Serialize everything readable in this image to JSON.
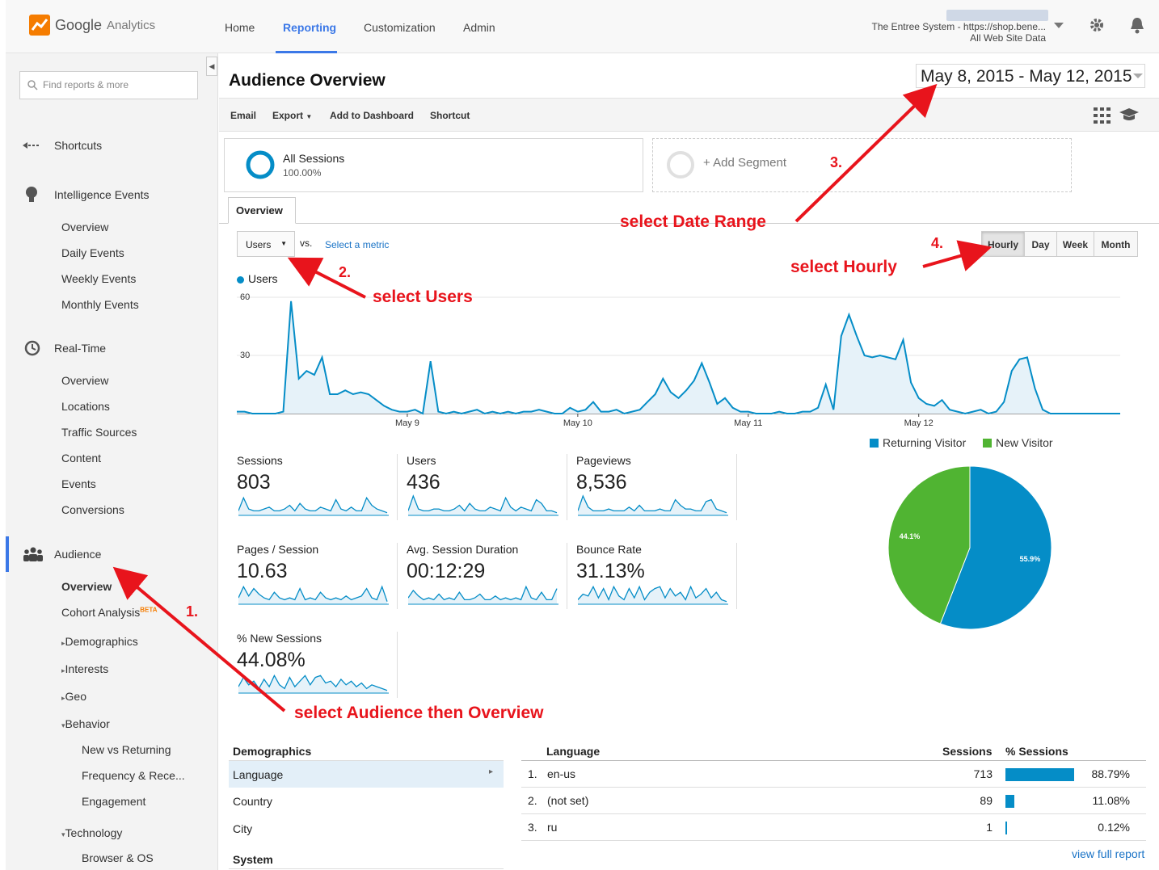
{
  "app": {
    "name_google": "Google",
    "name_product": "Analytics"
  },
  "nav": {
    "home": "Home",
    "reporting": "Reporting",
    "customization": "Customization",
    "admin": "Admin"
  },
  "account": {
    "line1": "The Entree System - https://shop.bene...",
    "line2": "All Web Site Data"
  },
  "sidebar": {
    "search_placeholder": "Find reports & more",
    "shortcuts": "Shortcuts",
    "intelligence": "Intelligence Events",
    "intel_items": [
      "Overview",
      "Daily Events",
      "Weekly Events",
      "Monthly Events"
    ],
    "realtime": "Real-Time",
    "rt_items": [
      "Overview",
      "Locations",
      "Traffic Sources",
      "Content",
      "Events",
      "Conversions"
    ],
    "audience": "Audience",
    "aud_overview": "Overview",
    "aud_cohort": "Cohort Analysis",
    "aud_beta": "BETA",
    "aud_demographics": "Demographics",
    "aud_interests": "Interests",
    "aud_geo": "Geo",
    "aud_behavior": "Behavior",
    "behavior_items": [
      "New vs Returning",
      "Frequency & Rece...",
      "Engagement"
    ],
    "aud_technology": "Technology",
    "tech_items": [
      "Browser & OS"
    ]
  },
  "page": {
    "title": "Audience Overview",
    "date_start": "May 8, 2015",
    "date_sep": "-",
    "date_end": "May 12, 2015"
  },
  "toolbar": {
    "email": "Email",
    "export": "Export",
    "add_dashboard": "Add to Dashboard",
    "shortcut": "Shortcut"
  },
  "segments": {
    "all": "All Sessions",
    "all_pct": "100.00%",
    "add": "+ Add Segment"
  },
  "tabs": {
    "overview": "Overview"
  },
  "controls": {
    "metric": "Users",
    "vs": "vs.",
    "select_metric": "Select a metric",
    "hourly": "Hourly",
    "day": "Day",
    "week": "Week",
    "month": "Month"
  },
  "chart_data": {
    "type": "line",
    "series": [
      {
        "name": "Users",
        "values": [
          1,
          1,
          0,
          0,
          0,
          0,
          1,
          58,
          18,
          22,
          20,
          29,
          10,
          10,
          12,
          10,
          11,
          10,
          7,
          4,
          2,
          1,
          1,
          2,
          0,
          27,
          1,
          0,
          1,
          0,
          1,
          2,
          0,
          1,
          0,
          1,
          0,
          1,
          1,
          2,
          1,
          0,
          0,
          3,
          1,
          2,
          6,
          1,
          1,
          2,
          0,
          1,
          2,
          6,
          10,
          18,
          11,
          8,
          12,
          17,
          26,
          16,
          5,
          8,
          3,
          1,
          1,
          0,
          0,
          0,
          1,
          0,
          0,
          1,
          1,
          3,
          15,
          2,
          40,
          51,
          40,
          30,
          29,
          30,
          29,
          28,
          38,
          16,
          8,
          5,
          4,
          7,
          2,
          1,
          0,
          1,
          2,
          0,
          1,
          6,
          22,
          28,
          29,
          13,
          2,
          0,
          0,
          0,
          0,
          0,
          0,
          0,
          0,
          0,
          0
        ]
      }
    ],
    "x_labels": [
      "May 9",
      "May 10",
      "May 11",
      "May 12"
    ],
    "y_ticks": [
      60,
      30
    ],
    "ylim": [
      0,
      60
    ]
  },
  "metrics": [
    {
      "label": "Sessions",
      "value": "803"
    },
    {
      "label": "Users",
      "value": "436"
    },
    {
      "label": "Pageviews",
      "value": "8,536"
    },
    {
      "label": "Pages / Session",
      "value": "10.63"
    },
    {
      "label": "Avg. Session Duration",
      "value": "00:12:29"
    },
    {
      "label": "Bounce Rate",
      "value": "31.13%"
    },
    {
      "label": "% New Sessions",
      "value": "44.08%"
    }
  ],
  "pie": {
    "type": "pie",
    "slices": [
      {
        "name": "Returning Visitor",
        "value": 55.9,
        "label": "55.9%"
      },
      {
        "name": "New Visitor",
        "value": 44.1,
        "label": "44.1%"
      }
    ],
    "colors": [
      "#058dc7",
      "#50b432"
    ]
  },
  "demographics": {
    "header": "Demographics",
    "items": [
      "Language",
      "Country",
      "City"
    ],
    "system": "System"
  },
  "language_table": {
    "h_lang": "Language",
    "h_sessions": "Sessions",
    "h_pct": "% Sessions",
    "rows": [
      {
        "n": "1.",
        "lang": "en-us",
        "sessions": "713",
        "pct": "88.79%",
        "frac": 0.8879
      },
      {
        "n": "2.",
        "lang": "(not set)",
        "sessions": "89",
        "pct": "11.08%",
        "frac": 0.1108
      },
      {
        "n": "3.",
        "lang": "ru",
        "sessions": "1",
        "pct": "0.12%",
        "frac": 0.0012
      }
    ],
    "full": "view full report"
  },
  "annotations": {
    "n1": "1.",
    "n2": "2.",
    "n3": "3.",
    "n4": "4.",
    "t1": "select Audience then Overview",
    "t2": "select Users",
    "t3": "select Date Range",
    "t4": "select Hourly"
  },
  "colors": {
    "accent": "#3b78e7",
    "series": "#058dc7",
    "annotation": "#e8141c"
  }
}
